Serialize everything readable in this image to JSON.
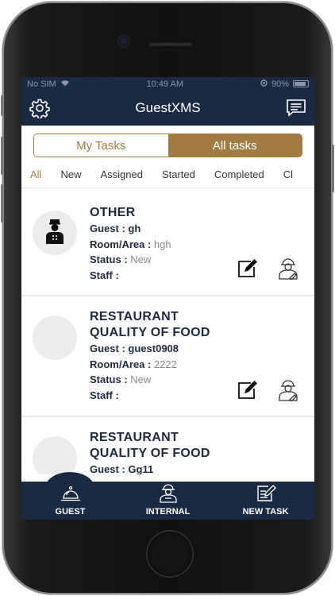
{
  "status_bar": {
    "carrier": "No SIM",
    "time": "10:49 AM",
    "battery": "90%"
  },
  "nav": {
    "title": "GuestXMS",
    "left_icon": "gear-icon",
    "right_icon": "chat-icon"
  },
  "segments": [
    {
      "label": "My Tasks",
      "selected": false
    },
    {
      "label": "All tasks",
      "selected": true
    }
  ],
  "filters": [
    "All",
    "New",
    "Assigned",
    "Started",
    "Completed",
    "Cl"
  ],
  "active_filter": "All",
  "tasks": [
    {
      "title_lines": [
        "OTHER"
      ],
      "guest_label": "Guest :",
      "guest": "gh",
      "room_label": "Room/Area :",
      "room": "hgh",
      "status_label": "Status :",
      "status": "New",
      "staff_label": "Staff :",
      "staff": "",
      "avatar": "bellboy-icon"
    },
    {
      "title_lines": [
        "RESTAURANT",
        "QUALITY OF FOOD"
      ],
      "guest_label": "Guest :",
      "guest": "guest0908",
      "room_label": "Room/Area :",
      "room": "2222",
      "status_label": "Status :",
      "status": "New",
      "staff_label": "Staff :",
      "staff": "",
      "avatar": ""
    },
    {
      "title_lines": [
        "RESTAURANT",
        "QUALITY OF FOOD"
      ],
      "guest_label": "Guest :",
      "guest": "Gg11",
      "avatar": ""
    }
  ],
  "tabbar": [
    {
      "label": "GUEST",
      "icon": "bell-icon"
    },
    {
      "label": "INTERNAL",
      "icon": "staff-icon"
    },
    {
      "label": "NEW TASK",
      "icon": "new-task-icon"
    }
  ],
  "colors": {
    "navy": "#192a42",
    "accent": "#a37c43",
    "text": "#1d2a3f",
    "muted": "#8a8a8a"
  }
}
